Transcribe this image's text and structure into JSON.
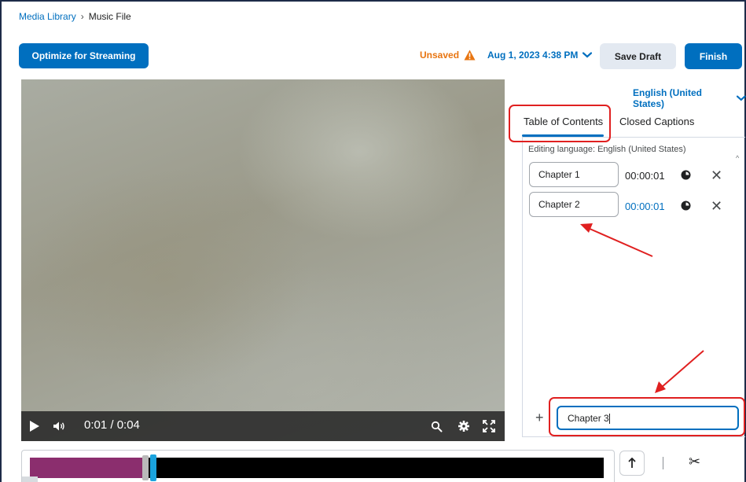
{
  "breadcrumb": {
    "parent": "Media Library",
    "separator": "›",
    "current": "Music File"
  },
  "toolbar": {
    "optimize_label": "Optimize for Streaming",
    "unsaved_label": "Unsaved",
    "date_label": "Aug 1, 2023 4:38 PM",
    "save_draft_label": "Save Draft",
    "finish_label": "Finish"
  },
  "player": {
    "time": "0:01 / 0:04"
  },
  "side_panel": {
    "language": "English (United States)",
    "tabs": [
      {
        "label": "Table of Contents",
        "active": true
      },
      {
        "label": "Closed Captions",
        "active": false
      }
    ],
    "editing_language": "Editing language: English (United States)",
    "chapters": [
      {
        "title": "Chapter 1",
        "time": "00:00:01"
      },
      {
        "title": "Chapter 2",
        "time": "00:00:01"
      }
    ],
    "new_chapter_value": "Chapter 3"
  },
  "timeline": {
    "progress_fraction": 0.25
  },
  "colors": {
    "accent": "#006fbf",
    "warning": "#e87511",
    "annotation": "#e02020",
    "timeline_played": "#8b2e6e",
    "playhead": "#1aa3de"
  },
  "icons": [
    "warning-icon",
    "chevron-down-icon",
    "play-icon",
    "volume-icon",
    "zoom-icon",
    "gear-icon",
    "fullscreen-icon",
    "clock-icon",
    "close-icon",
    "plus-icon",
    "arrow-up-icon",
    "scissors-icon"
  ]
}
